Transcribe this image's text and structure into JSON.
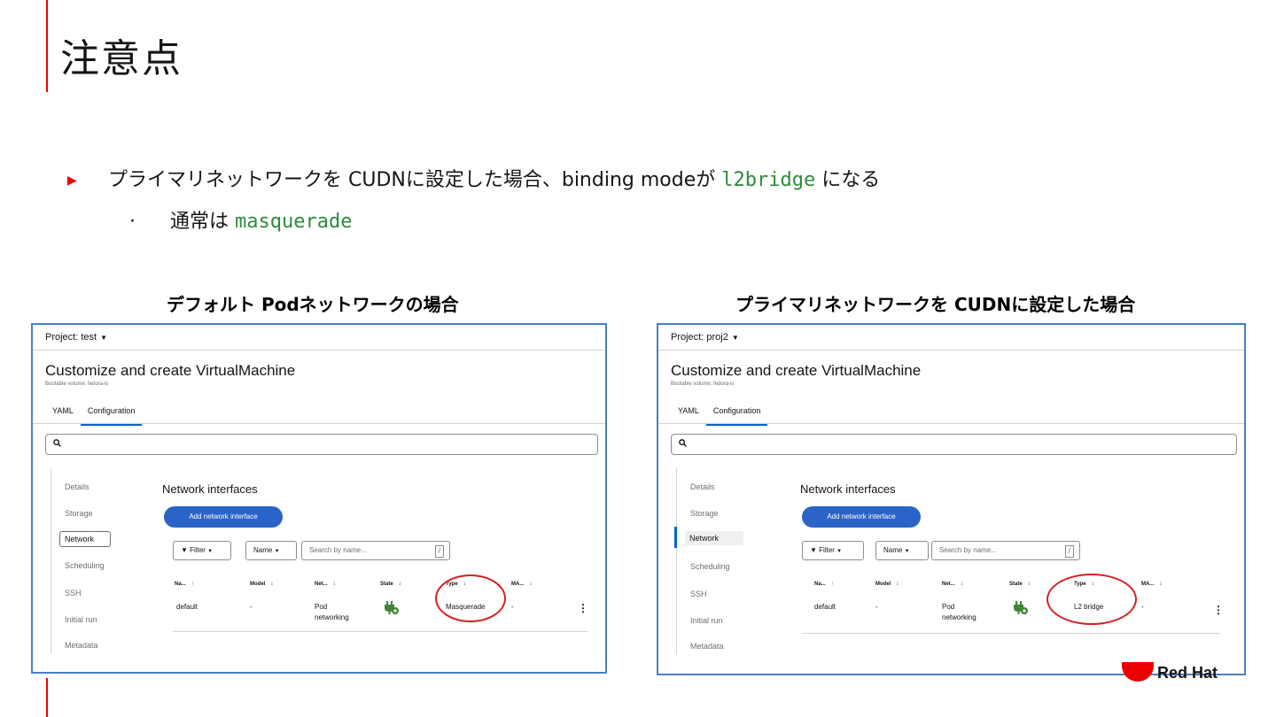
{
  "slide": {
    "title": "注意点",
    "bullet1_text": "プライマリネットワークを CUDNに設定した場合、binding modeが ",
    "bullet1_code": "l2bridge",
    "bullet1_suffix": " になる",
    "bullet2_prefix": "通常は ",
    "bullet2_code": "masquerade",
    "bullet2_marker": "·",
    "bullet1_marker": "▶"
  },
  "captions": {
    "left": "デフォルト Podネットワークの場合",
    "right": "プライマリネットワークを CUDNに設定した場合"
  },
  "left_panel": {
    "project": "Project: test",
    "heading": "Customize and create VirtualMachine",
    "subtitle": "Bootable volume: fedora-is",
    "tabs": [
      "YAML",
      "Configuration"
    ],
    "nav": [
      "Details",
      "Storage",
      "Network",
      "Scheduling",
      "SSH",
      "Initial run",
      "Metadata"
    ],
    "section_title": "Network interfaces",
    "add_button": "Add network interface",
    "filter": "Filter",
    "name_select": "Name",
    "search_placeholder": "Search by name...",
    "slash": "/",
    "columns": [
      "Na...",
      "Model",
      "Net...",
      "State",
      "Type",
      "MA..."
    ],
    "row": {
      "name": "default",
      "model": "-",
      "network_l1": "Pod",
      "network_l2": "networking",
      "type": "Masquerade",
      "mac": "-"
    }
  },
  "right_panel": {
    "project": "Project: proj2",
    "heading": "Customize and create VirtualMachine",
    "subtitle": "Bootable volume: fedora-is",
    "tabs": [
      "YAML",
      "Configuration"
    ],
    "nav": [
      "Details",
      "Storage",
      "Network",
      "Scheduling",
      "SSH",
      "Initial run",
      "Metadata"
    ],
    "section_title": "Network interfaces",
    "add_button": "Add network interface",
    "filter": "Filter",
    "name_select": "Name",
    "search_placeholder": "Search by name...",
    "slash": "/",
    "columns": [
      "Na...",
      "Model",
      "Net...",
      "State",
      "Type",
      "MA..."
    ],
    "row": {
      "name": "default",
      "model": "-",
      "network_l1": "Pod",
      "network_l2": "networking",
      "type": "L2 bridge",
      "mac": "-"
    }
  },
  "logo": {
    "text": "Red Hat"
  },
  "colors": {
    "accent": "#ee0000",
    "code": "#2e8b3d",
    "panel_border": "#4a7fc4",
    "button": "#2b64c8",
    "highlight_circle": "#d51f1f",
    "state_icon": "#3e8635"
  },
  "icons": {
    "search": "search-icon",
    "filter": "filter-icon",
    "caret": "caret-down-icon",
    "sort": "sort-icon",
    "state": "plug-icon",
    "kebab": "kebab-icon"
  }
}
